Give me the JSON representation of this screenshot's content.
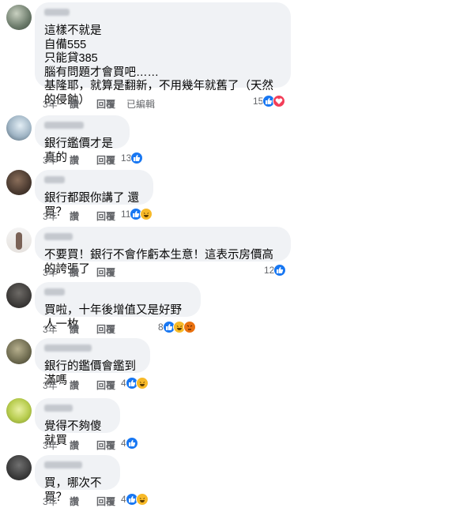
{
  "comments": [
    {
      "text": "這樣不就是\n自備555\n只能貸385\n腦有問題才會買吧……\n基隆耶，就算是翻新，不用幾年就舊了（天然的侵蝕）",
      "time": "3年",
      "like": "讚",
      "reply": "回覆",
      "edited": "已編輯",
      "count": "15",
      "reactions": [
        "like",
        "love"
      ]
    },
    {
      "text": "銀行鑑價才是真的",
      "time": "3年",
      "like": "讚",
      "reply": "回覆",
      "count": "13",
      "reactions": [
        "like"
      ]
    },
    {
      "text": "銀行都跟你講了 還買？",
      "time": "3年",
      "like": "讚",
      "reply": "回覆",
      "count": "11",
      "reactions": [
        "like",
        "haha"
      ]
    },
    {
      "text": "不要買！銀行不會作虧本生意！這表示房價高的誇張了",
      "time": "3年",
      "like": "讚",
      "reply": "回覆",
      "count": "12",
      "reactions": [
        "like"
      ]
    },
    {
      "text": "買啦，十年後增值又是好野人一枚",
      "time": "3年",
      "like": "讚",
      "reply": "回覆",
      "count": "8",
      "reactions": [
        "like",
        "haha",
        "angry"
      ]
    },
    {
      "text": "銀行的鑑價會鑑到滿嗎",
      "time": "3年",
      "like": "讚",
      "reply": "回覆",
      "count": "4",
      "reactions": [
        "like",
        "haha"
      ]
    },
    {
      "text": "覺得不夠傻就買",
      "time": "3年",
      "like": "讚",
      "reply": "回覆",
      "count": "4",
      "reactions": [
        "like"
      ]
    },
    {
      "text": "買，哪次不買？",
      "time": "3年",
      "like": "讚",
      "reply": "回覆",
      "count": "4",
      "reactions": [
        "like",
        "haha"
      ]
    }
  ],
  "colors": {
    "bubble": "#f0f2f5",
    "like": "#1877f2",
    "love": "#f33e58",
    "haha": "#f7b928",
    "angry": "#e9710f",
    "meta": "#65676b"
  }
}
